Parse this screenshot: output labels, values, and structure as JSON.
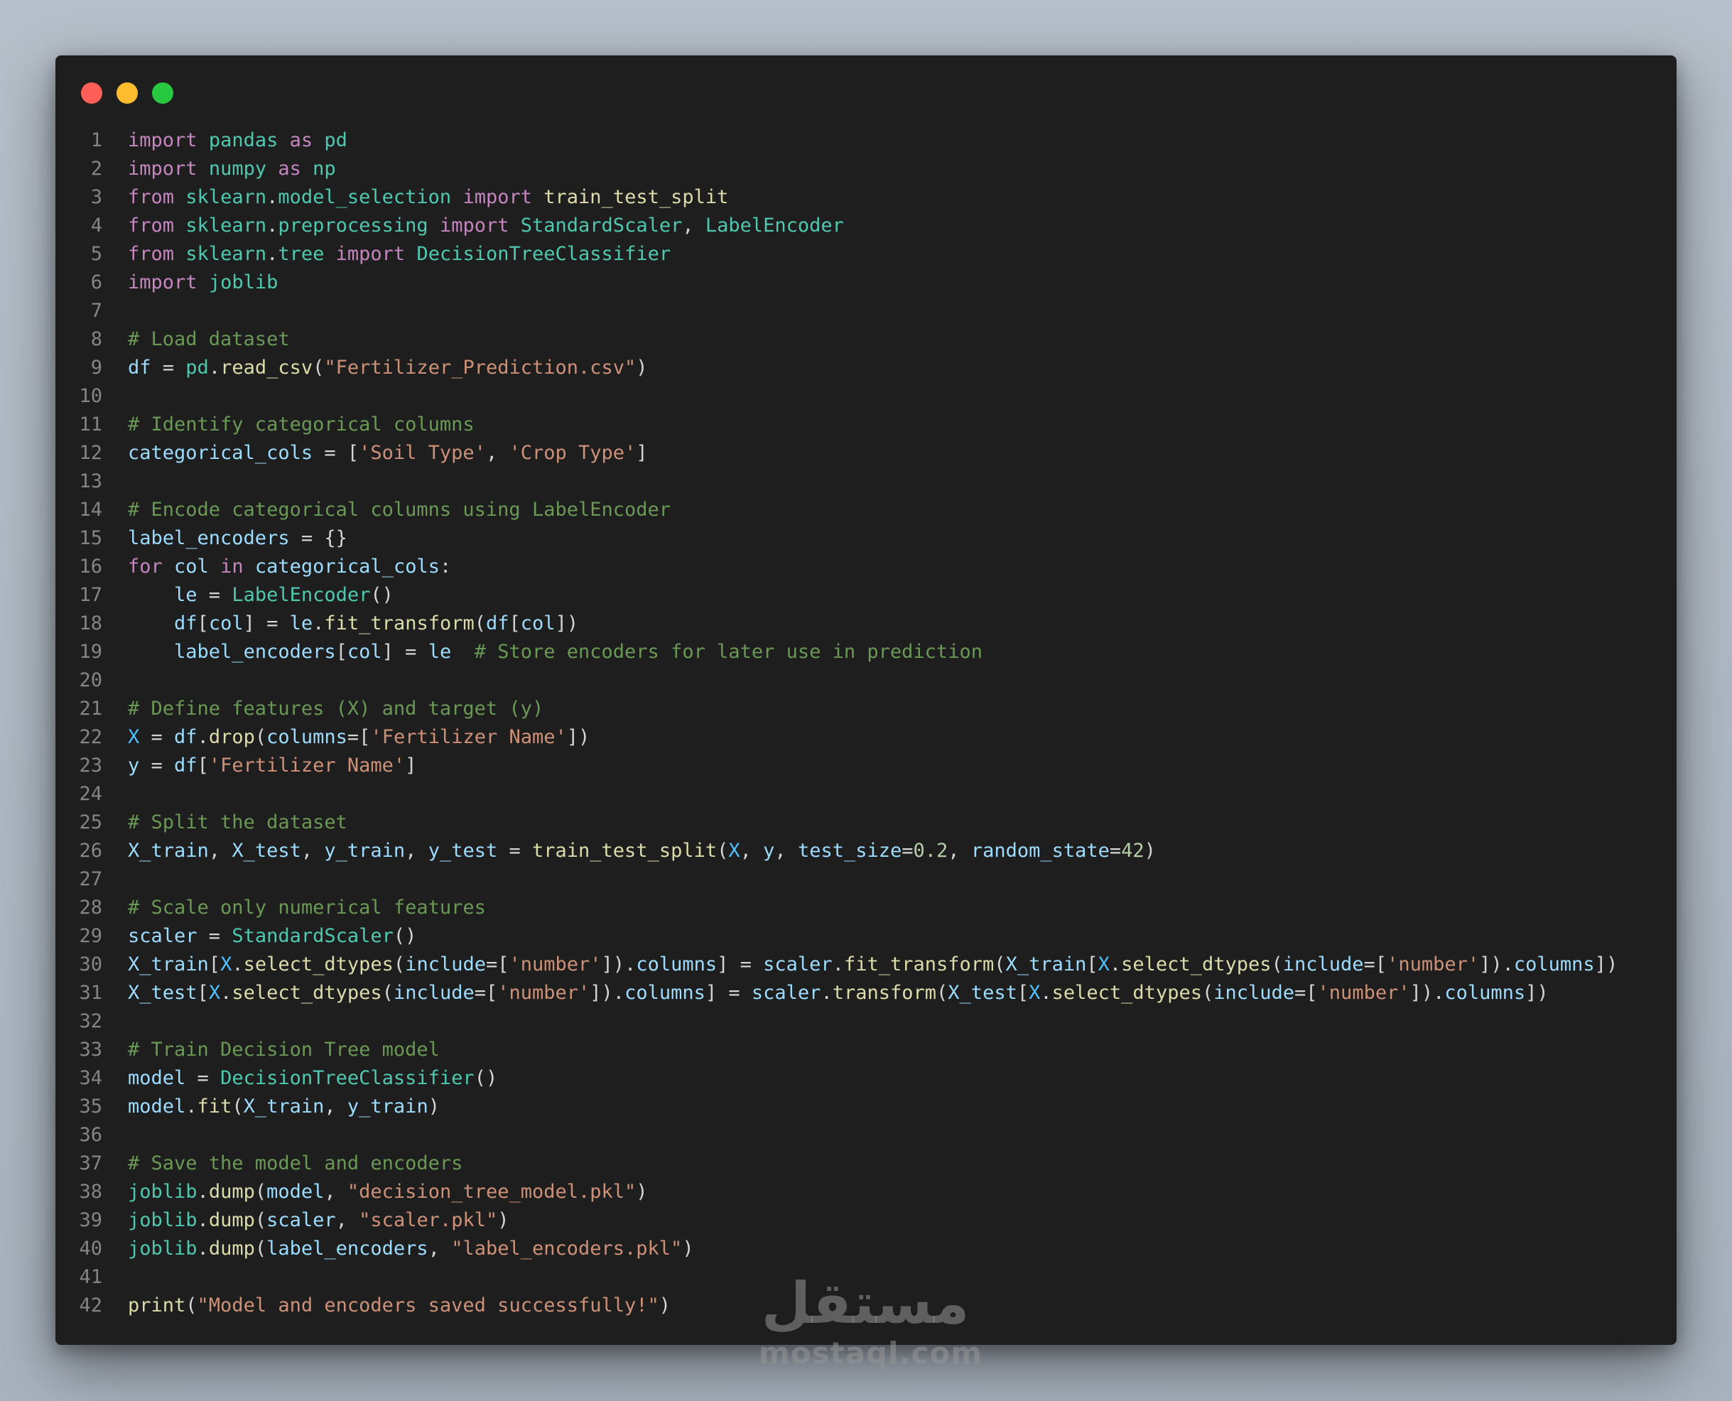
{
  "window": {
    "controls": [
      {
        "name": "close",
        "color": "#ff5f57"
      },
      {
        "name": "minimize",
        "color": "#febc2e"
      },
      {
        "name": "maximize",
        "color": "#28c840"
      }
    ]
  },
  "theme": {
    "background": "#1e1e1e",
    "line_number": "#858585",
    "keyword": "#c586c0",
    "module": "#4ec9b0",
    "function": "#dcdcaa",
    "variable": "#9cdcfe",
    "string": "#ce9178",
    "number": "#b5cea8",
    "comment": "#6a9955",
    "constant": "#4fc1ff"
  },
  "code": {
    "lines": [
      [
        [
          "kw",
          "import"
        ],
        [
          "op",
          " "
        ],
        [
          "mod",
          "pandas"
        ],
        [
          "op",
          " "
        ],
        [
          "kw",
          "as"
        ],
        [
          "op",
          " "
        ],
        [
          "mod",
          "pd"
        ]
      ],
      [
        [
          "kw",
          "import"
        ],
        [
          "op",
          " "
        ],
        [
          "mod",
          "numpy"
        ],
        [
          "op",
          " "
        ],
        [
          "kw",
          "as"
        ],
        [
          "op",
          " "
        ],
        [
          "mod",
          "np"
        ]
      ],
      [
        [
          "kw",
          "from"
        ],
        [
          "op",
          " "
        ],
        [
          "mod",
          "sklearn"
        ],
        [
          "op",
          "."
        ],
        [
          "mod",
          "model_selection"
        ],
        [
          "op",
          " "
        ],
        [
          "kw",
          "import"
        ],
        [
          "op",
          " "
        ],
        [
          "fn",
          "train_test_split"
        ]
      ],
      [
        [
          "kw",
          "from"
        ],
        [
          "op",
          " "
        ],
        [
          "mod",
          "sklearn"
        ],
        [
          "op",
          "."
        ],
        [
          "mod",
          "preprocessing"
        ],
        [
          "op",
          " "
        ],
        [
          "kw",
          "import"
        ],
        [
          "op",
          " "
        ],
        [
          "mod",
          "StandardScaler"
        ],
        [
          "op",
          ", "
        ],
        [
          "mod",
          "LabelEncoder"
        ]
      ],
      [
        [
          "kw",
          "from"
        ],
        [
          "op",
          " "
        ],
        [
          "mod",
          "sklearn"
        ],
        [
          "op",
          "."
        ],
        [
          "mod",
          "tree"
        ],
        [
          "op",
          " "
        ],
        [
          "kw",
          "import"
        ],
        [
          "op",
          " "
        ],
        [
          "mod",
          "DecisionTreeClassifier"
        ]
      ],
      [
        [
          "kw",
          "import"
        ],
        [
          "op",
          " "
        ],
        [
          "mod",
          "joblib"
        ]
      ],
      [],
      [
        [
          "cmt",
          "# Load dataset"
        ]
      ],
      [
        [
          "var",
          "df"
        ],
        [
          "op",
          " = "
        ],
        [
          "mod",
          "pd"
        ],
        [
          "op",
          "."
        ],
        [
          "fn",
          "read_csv"
        ],
        [
          "op",
          "("
        ],
        [
          "str",
          "\"Fertilizer_Prediction.csv\""
        ],
        [
          "op",
          ")"
        ]
      ],
      [],
      [
        [
          "cmt",
          "# Identify categorical columns"
        ]
      ],
      [
        [
          "var",
          "categorical_cols"
        ],
        [
          "op",
          " = ["
        ],
        [
          "str",
          "'Soil Type'"
        ],
        [
          "op",
          ", "
        ],
        [
          "str",
          "'Crop Type'"
        ],
        [
          "op",
          "]"
        ]
      ],
      [],
      [
        [
          "cmt",
          "# Encode categorical columns using LabelEncoder"
        ]
      ],
      [
        [
          "var",
          "label_encoders"
        ],
        [
          "op",
          " = {}"
        ]
      ],
      [
        [
          "kw",
          "for"
        ],
        [
          "op",
          " "
        ],
        [
          "var",
          "col"
        ],
        [
          "op",
          " "
        ],
        [
          "kw",
          "in"
        ],
        [
          "op",
          " "
        ],
        [
          "var",
          "categorical_cols"
        ],
        [
          "op",
          ":"
        ]
      ],
      [
        [
          "op",
          "    "
        ],
        [
          "var",
          "le"
        ],
        [
          "op",
          " = "
        ],
        [
          "mod",
          "LabelEncoder"
        ],
        [
          "op",
          "()"
        ]
      ],
      [
        [
          "op",
          "    "
        ],
        [
          "var",
          "df"
        ],
        [
          "op",
          "["
        ],
        [
          "var",
          "col"
        ],
        [
          "op",
          "] = "
        ],
        [
          "var",
          "le"
        ],
        [
          "op",
          "."
        ],
        [
          "fn",
          "fit_transform"
        ],
        [
          "op",
          "("
        ],
        [
          "var",
          "df"
        ],
        [
          "op",
          "["
        ],
        [
          "var",
          "col"
        ],
        [
          "op",
          "])"
        ]
      ],
      [
        [
          "op",
          "    "
        ],
        [
          "var",
          "label_encoders"
        ],
        [
          "op",
          "["
        ],
        [
          "var",
          "col"
        ],
        [
          "op",
          "] = "
        ],
        [
          "var",
          "le"
        ],
        [
          "op",
          "  "
        ],
        [
          "cmt",
          "# Store encoders for later use in prediction"
        ]
      ],
      [],
      [
        [
          "cmt",
          "# Define features (X) and target (y)"
        ]
      ],
      [
        [
          "con",
          "X"
        ],
        [
          "op",
          " = "
        ],
        [
          "var",
          "df"
        ],
        [
          "op",
          "."
        ],
        [
          "fn",
          "drop"
        ],
        [
          "op",
          "("
        ],
        [
          "var",
          "columns"
        ],
        [
          "op",
          "=["
        ],
        [
          "str",
          "'Fertilizer Name'"
        ],
        [
          "op",
          "])"
        ]
      ],
      [
        [
          "var",
          "y"
        ],
        [
          "op",
          " = "
        ],
        [
          "var",
          "df"
        ],
        [
          "op",
          "["
        ],
        [
          "str",
          "'Fertilizer Name'"
        ],
        [
          "op",
          "]"
        ]
      ],
      [],
      [
        [
          "cmt",
          "# Split the dataset"
        ]
      ],
      [
        [
          "var",
          "X_train"
        ],
        [
          "op",
          ", "
        ],
        [
          "var",
          "X_test"
        ],
        [
          "op",
          ", "
        ],
        [
          "var",
          "y_train"
        ],
        [
          "op",
          ", "
        ],
        [
          "var",
          "y_test"
        ],
        [
          "op",
          " = "
        ],
        [
          "fn",
          "train_test_split"
        ],
        [
          "op",
          "("
        ],
        [
          "con",
          "X"
        ],
        [
          "op",
          ", "
        ],
        [
          "var",
          "y"
        ],
        [
          "op",
          ", "
        ],
        [
          "var",
          "test_size"
        ],
        [
          "op",
          "="
        ],
        [
          "num",
          "0.2"
        ],
        [
          "op",
          ", "
        ],
        [
          "var",
          "random_state"
        ],
        [
          "op",
          "="
        ],
        [
          "num",
          "42"
        ],
        [
          "op",
          ")"
        ]
      ],
      [],
      [
        [
          "cmt",
          "# Scale only numerical features"
        ]
      ],
      [
        [
          "var",
          "scaler"
        ],
        [
          "op",
          " = "
        ],
        [
          "mod",
          "StandardScaler"
        ],
        [
          "op",
          "()"
        ]
      ],
      [
        [
          "var",
          "X_train"
        ],
        [
          "op",
          "["
        ],
        [
          "con",
          "X"
        ],
        [
          "op",
          "."
        ],
        [
          "fn",
          "select_dtypes"
        ],
        [
          "op",
          "("
        ],
        [
          "var",
          "include"
        ],
        [
          "op",
          "=["
        ],
        [
          "str",
          "'number'"
        ],
        [
          "op",
          "])."
        ],
        [
          "var",
          "columns"
        ],
        [
          "op",
          "] = "
        ],
        [
          "var",
          "scaler"
        ],
        [
          "op",
          "."
        ],
        [
          "fn",
          "fit_transform"
        ],
        [
          "op",
          "("
        ],
        [
          "var",
          "X_train"
        ],
        [
          "op",
          "["
        ],
        [
          "con",
          "X"
        ],
        [
          "op",
          "."
        ],
        [
          "fn",
          "select_dtypes"
        ],
        [
          "op",
          "("
        ],
        [
          "var",
          "include"
        ],
        [
          "op",
          "=["
        ],
        [
          "str",
          "'number'"
        ],
        [
          "op",
          "])."
        ],
        [
          "var",
          "columns"
        ],
        [
          "op",
          "])"
        ]
      ],
      [
        [
          "var",
          "X_test"
        ],
        [
          "op",
          "["
        ],
        [
          "con",
          "X"
        ],
        [
          "op",
          "."
        ],
        [
          "fn",
          "select_dtypes"
        ],
        [
          "op",
          "("
        ],
        [
          "var",
          "include"
        ],
        [
          "op",
          "=["
        ],
        [
          "str",
          "'number'"
        ],
        [
          "op",
          "])."
        ],
        [
          "var",
          "columns"
        ],
        [
          "op",
          "] = "
        ],
        [
          "var",
          "scaler"
        ],
        [
          "op",
          "."
        ],
        [
          "fn",
          "transform"
        ],
        [
          "op",
          "("
        ],
        [
          "var",
          "X_test"
        ],
        [
          "op",
          "["
        ],
        [
          "con",
          "X"
        ],
        [
          "op",
          "."
        ],
        [
          "fn",
          "select_dtypes"
        ],
        [
          "op",
          "("
        ],
        [
          "var",
          "include"
        ],
        [
          "op",
          "=["
        ],
        [
          "str",
          "'number'"
        ],
        [
          "op",
          "])."
        ],
        [
          "var",
          "columns"
        ],
        [
          "op",
          "])"
        ]
      ],
      [],
      [
        [
          "cmt",
          "# Train Decision Tree model"
        ]
      ],
      [
        [
          "var",
          "model"
        ],
        [
          "op",
          " = "
        ],
        [
          "mod",
          "DecisionTreeClassifier"
        ],
        [
          "op",
          "()"
        ]
      ],
      [
        [
          "var",
          "model"
        ],
        [
          "op",
          "."
        ],
        [
          "fn",
          "fit"
        ],
        [
          "op",
          "("
        ],
        [
          "var",
          "X_train"
        ],
        [
          "op",
          ", "
        ],
        [
          "var",
          "y_train"
        ],
        [
          "op",
          ")"
        ]
      ],
      [],
      [
        [
          "cmt",
          "# Save the model and encoders"
        ]
      ],
      [
        [
          "mod",
          "joblib"
        ],
        [
          "op",
          "."
        ],
        [
          "fn",
          "dump"
        ],
        [
          "op",
          "("
        ],
        [
          "var",
          "model"
        ],
        [
          "op",
          ", "
        ],
        [
          "str",
          "\"decision_tree_model.pkl\""
        ],
        [
          "op",
          ")"
        ]
      ],
      [
        [
          "mod",
          "joblib"
        ],
        [
          "op",
          "."
        ],
        [
          "fn",
          "dump"
        ],
        [
          "op",
          "("
        ],
        [
          "var",
          "scaler"
        ],
        [
          "op",
          ", "
        ],
        [
          "str",
          "\"scaler.pkl\""
        ],
        [
          "op",
          ")"
        ]
      ],
      [
        [
          "mod",
          "joblib"
        ],
        [
          "op",
          "."
        ],
        [
          "fn",
          "dump"
        ],
        [
          "op",
          "("
        ],
        [
          "var",
          "label_encoders"
        ],
        [
          "op",
          ", "
        ],
        [
          "str",
          "\"label_encoders.pkl\""
        ],
        [
          "op",
          ")"
        ]
      ],
      [],
      [
        [
          "fn",
          "print"
        ],
        [
          "op",
          "("
        ],
        [
          "str",
          "\"Model and encoders saved successfully!\""
        ],
        [
          "op",
          ")"
        ]
      ]
    ]
  },
  "watermark": {
    "arabic": "مستقل",
    "latin": "mostaql.com"
  }
}
